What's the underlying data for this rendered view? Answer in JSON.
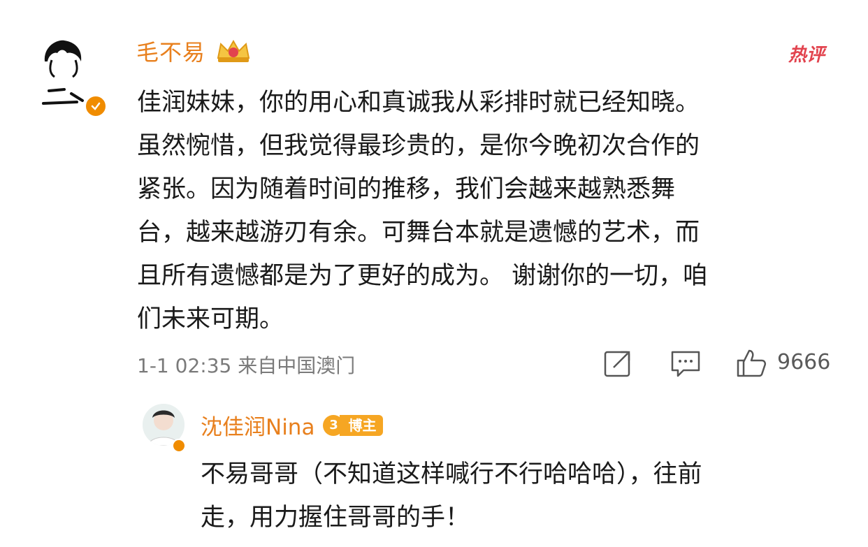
{
  "comment": {
    "author": "毛不易",
    "hot_tag": "热评",
    "lines": [
      "佳润妹妹，你的用心和真诚我从彩排时就已经知晓。",
      "虽然惋惜，但我觉得最珍贵的，是你今晚初次合作的",
      "紧张。因为随着时间的推移，我们会越来越熟悉舞",
      "台，越来越游刃有余。可舞台本就是遗憾的艺术，而",
      "且所有遗憾都是为了更好的成为。 谢谢你的一切，咱",
      "们未来可期。"
    ],
    "meta": "1-1 02:35  来自中国澳门",
    "like_count": "9666"
  },
  "reply": {
    "author": "沈佳润Nina",
    "badge_level": "3",
    "badge_tag": "博主",
    "lines": [
      "不易哥哥（不知道这样喊行不行哈哈哈），往前",
      "走，用力握住哥哥的手！"
    ]
  },
  "colors": {
    "username": "#e8801e",
    "hot": "#e2434e",
    "verified": "#f08c00",
    "meta": "#7a7a7a"
  },
  "icons": [
    "avatar",
    "verified-icon",
    "crown-badge-icon",
    "share-icon",
    "comment-icon",
    "like-icon",
    "blogger-badge-icon"
  ]
}
